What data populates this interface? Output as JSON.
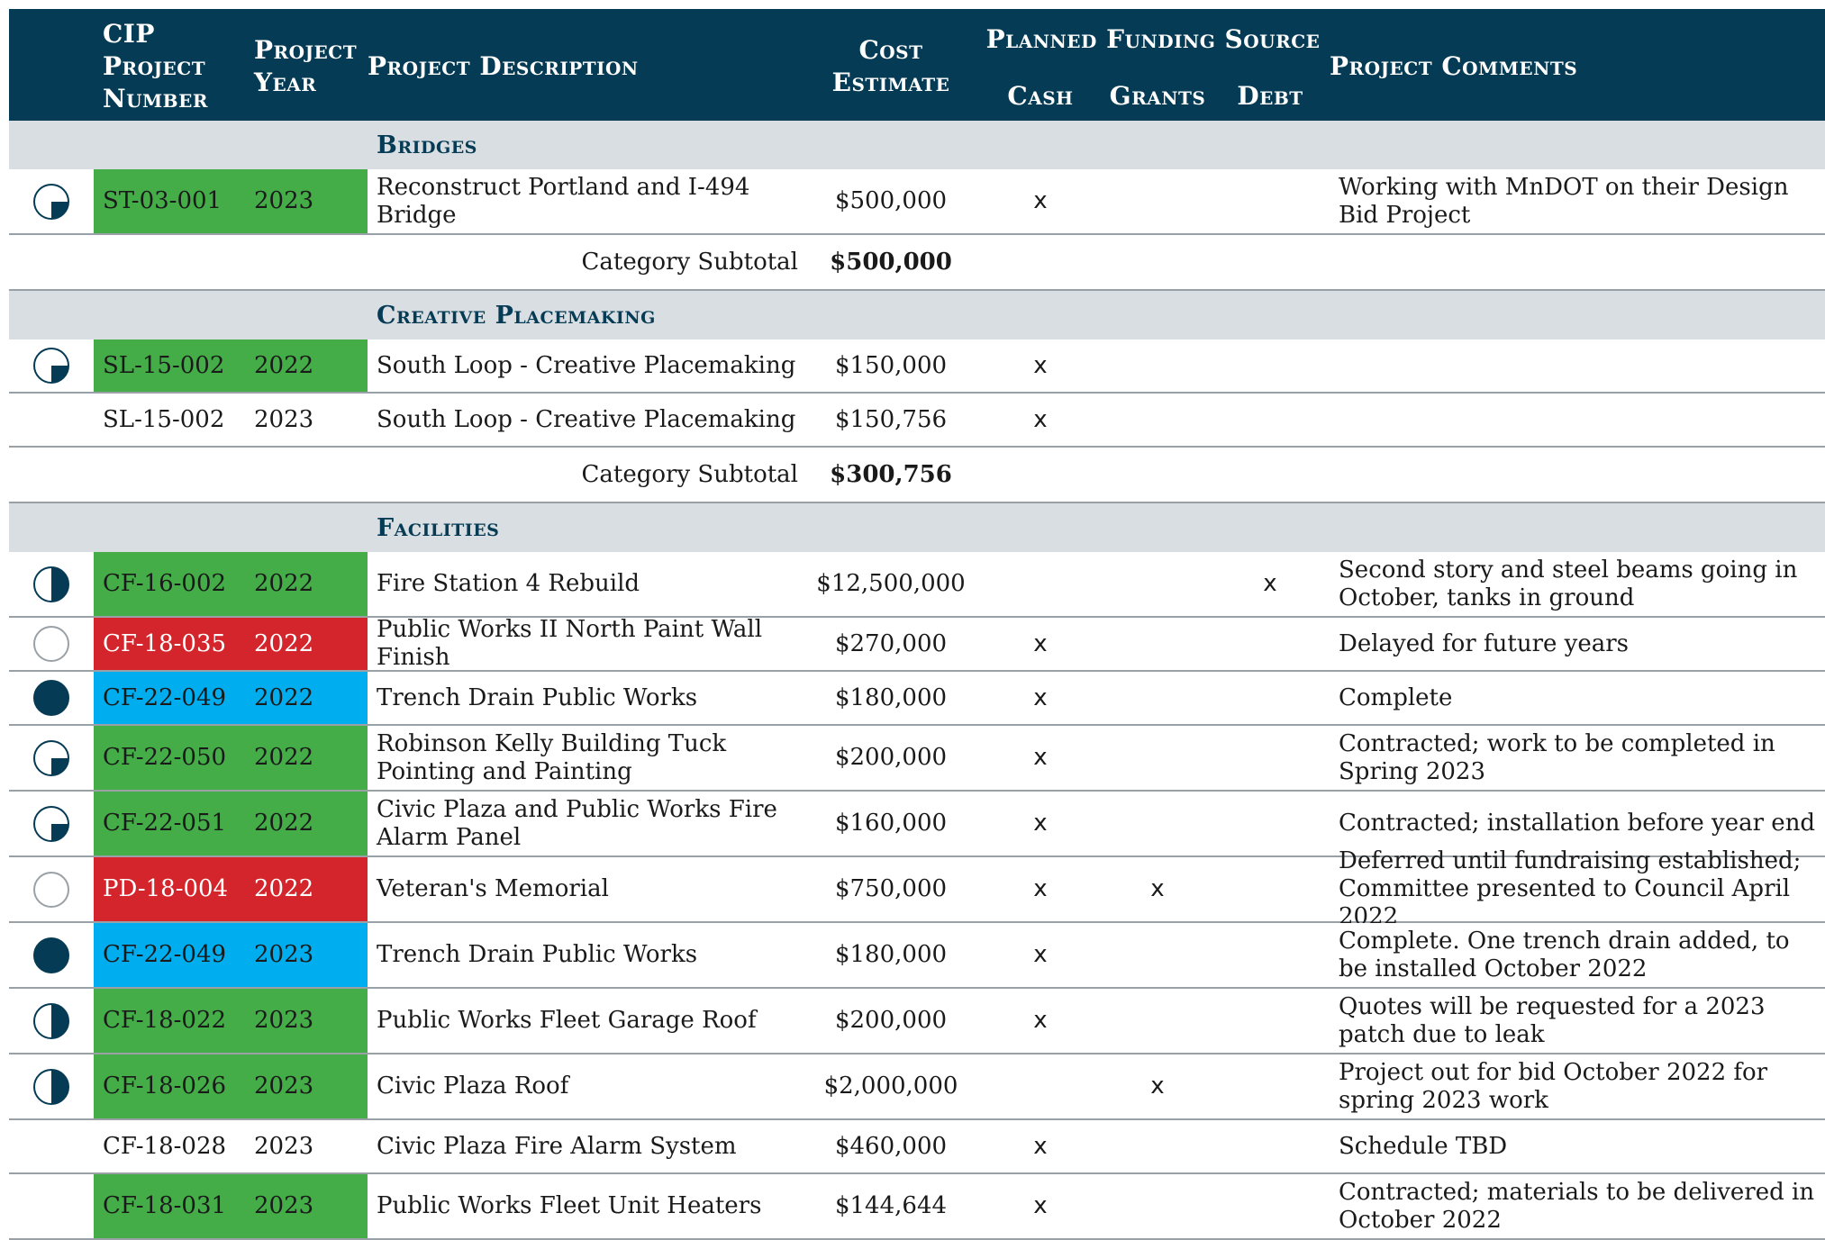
{
  "header": {
    "cip": [
      "CIP",
      "Project",
      "Number"
    ],
    "year": [
      "Project",
      "Year"
    ],
    "description": "Project Description",
    "cost": [
      "Cost",
      "Estimate"
    ],
    "funding_source": "Planned Funding Source",
    "cash": "Cash",
    "grants": "Grants",
    "debt": "Debt",
    "comments": "Project Comments"
  },
  "colors": {
    "header_bg": "#053b54",
    "category_bg": "#d9dee3",
    "green": "#44ad48",
    "red": "#d3252b",
    "blue": "#00adef",
    "status_icon": "#053b54"
  },
  "sections": [
    {
      "category": "Bridges",
      "rows": [
        {
          "status": "three-quarter",
          "band": "green",
          "number": "ST-03-001",
          "year": "2023",
          "description": "Reconstruct Portland and I-494 Bridge",
          "cost": "$500,000",
          "cash": "x",
          "grants": "",
          "debt": "",
          "comment": "Working with MnDOT on their Design Bid Project"
        }
      ],
      "subtotal_label": "Category Subtotal",
      "subtotal": "$500,000"
    },
    {
      "category": "Creative Placemaking",
      "rows": [
        {
          "status": "three-quarter",
          "band": "green",
          "number": "SL-15-002",
          "year": "2022",
          "description": "South Loop - Creative Placemaking",
          "cost": "$150,000",
          "cash": "x",
          "grants": "",
          "debt": "",
          "comment": ""
        },
        {
          "status": "none",
          "band": "none",
          "number": "SL-15-002",
          "year": "2023",
          "description": "South Loop - Creative Placemaking",
          "cost": "$150,756",
          "cash": "x",
          "grants": "",
          "debt": "",
          "comment": ""
        }
      ],
      "subtotal_label": "Category Subtotal",
      "subtotal": "$300,756"
    },
    {
      "category": "Facilities",
      "rows": [
        {
          "status": "half",
          "band": "green",
          "number": "CF-16-002",
          "year": "2022",
          "description": "Fire Station 4 Rebuild",
          "cost": "$12,500,000",
          "cash": "",
          "grants": "",
          "debt": "x",
          "comment": "Second story and steel beams going in October, tanks in ground"
        },
        {
          "status": "empty",
          "band": "red",
          "number": "CF-18-035",
          "year": "2022",
          "description": "Public Works II North Paint Wall Finish",
          "cost": "$270,000",
          "cash": "x",
          "grants": "",
          "debt": "",
          "comment": "Delayed for future years"
        },
        {
          "status": "full",
          "band": "blue",
          "number": "CF-22-049",
          "year": "2022",
          "description": "Trench Drain Public Works",
          "cost": "$180,000",
          "cash": "x",
          "grants": "",
          "debt": "",
          "comment": "Complete"
        },
        {
          "status": "three-quarter",
          "band": "green",
          "number": "CF-22-050",
          "year": "2022",
          "description": "Robinson Kelly Building Tuck Pointing and Painting",
          "cost": "$200,000",
          "cash": "x",
          "grants": "",
          "debt": "",
          "comment": "Contracted; work to be completed in Spring 2023"
        },
        {
          "status": "three-quarter",
          "band": "green",
          "number": "CF-22-051",
          "year": "2022",
          "description": "Civic Plaza and Public Works Fire Alarm Panel",
          "cost": "$160,000",
          "cash": "x",
          "grants": "",
          "debt": "",
          "comment": "Contracted; installation before year end"
        },
        {
          "status": "empty",
          "band": "red",
          "number": "PD-18-004",
          "year": "2022",
          "description": "Veteran's Memorial",
          "cost": "$750,000",
          "cash": "x",
          "grants": "x",
          "debt": "",
          "comment": "Deferred until fundraising established; Committee presented to Council April 2022"
        },
        {
          "status": "full",
          "band": "blue",
          "number": "CF-22-049",
          "year": "2023",
          "description": "Trench Drain Public Works",
          "cost": "$180,000",
          "cash": "x",
          "grants": "",
          "debt": "",
          "comment": "Complete. One trench drain added, to be installed October 2022"
        },
        {
          "status": "half",
          "band": "green",
          "number": "CF-18-022",
          "year": "2023",
          "description": "Public Works Fleet Garage Roof",
          "cost": "$200,000",
          "cash": "x",
          "grants": "",
          "debt": "",
          "comment": "Quotes will be requested for a 2023 patch due to leak"
        },
        {
          "status": "half",
          "band": "green",
          "number": "CF-18-026",
          "year": "2023",
          "description": "Civic Plaza Roof",
          "cost": "$2,000,000",
          "cash": "",
          "grants": "x",
          "debt": "",
          "comment": "Project out for bid October 2022 for spring 2023 work"
        },
        {
          "status": "none",
          "band": "none",
          "number": "CF-18-028",
          "year": "2023",
          "description": "Civic Plaza Fire Alarm System",
          "cost": "$460,000",
          "cash": "x",
          "grants": "",
          "debt": "",
          "comment": "Schedule TBD"
        },
        {
          "status": "none",
          "band": "green",
          "number": "CF-18-031",
          "year": "2023",
          "description": "Public Works Fleet Unit Heaters",
          "cost": "$144,644",
          "cash": "x",
          "grants": "",
          "debt": "",
          "comment": "Contracted; materials to be delivered in October 2022"
        }
      ]
    }
  ]
}
